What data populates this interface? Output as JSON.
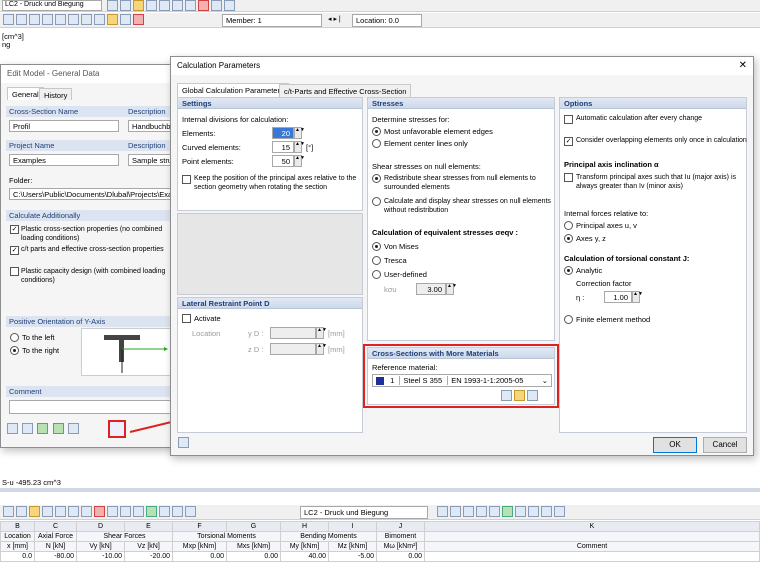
{
  "toolbar1": {
    "loadcase": "LC2 - Druck und Biegung"
  },
  "toolbar2": {
    "member": "Member: 1",
    "location": "Location: 0.0"
  },
  "bg_text": {
    "line1": "[cm^3]",
    "line2": "ng",
    "bottom": "S-u  -495.23 cm^3"
  },
  "edit_model": {
    "title": "Edit Model - General Data",
    "tabs": [
      "General",
      "History"
    ],
    "cross_section_name_label": "Cross-Section Name",
    "cross_section_name": "Profil",
    "description_label": "Description",
    "description_value": "Handbuchbe",
    "project_name_label": "Project Name",
    "project_name": "Examples",
    "project_desc_label": "Description",
    "project_desc": "Sample struc",
    "folder_label": "Folder:",
    "folder": "C:\\Users\\Public\\Documents\\Dlubal\\Projects\\Example",
    "calc_add_label": "Calculate Additionally",
    "opt1": "Plastic cross-section properties (no combined loading conditions)",
    "opt2": "c/t parts and effective cross-section properties",
    "opt3": "Plastic capacity design (with combined loading conditions)",
    "orientation_label": "Positive Orientation of Y-Axis",
    "to_left": "To the left",
    "to_right": "To the right",
    "comment_label": "Comment"
  },
  "calc": {
    "title": "Calculation Parameters",
    "tabs": [
      "Global Calculation Parameters",
      "c/t-Parts and Effective Cross-Section"
    ],
    "settings": {
      "head": "Settings",
      "internal_div": "Internal divisions for calculation:",
      "elements_label": "Elements:",
      "elements": "20",
      "curved_label": "Curved elements:",
      "curved": "15",
      "curved_unit": "[°]",
      "point_label": "Point elements:",
      "point": "50",
      "keep_pos": "Keep the position of the principal axes relative to the section geometry when rotating the section"
    },
    "lateral": {
      "head": "Lateral Restraint Point D",
      "activate": "Activate",
      "location": "Location",
      "y": "y D :",
      "z": "z D :",
      "unit": "[mm]"
    },
    "stresses": {
      "head": "Stresses",
      "determine": "Determine stresses for:",
      "most_unfav": "Most unfavorable element edges",
      "center": "Element center lines only",
      "shear_null": "Shear stresses on null elements:",
      "redistribute": "Redistribute shear stresses from null elements to surrounded elements",
      "calc_display": "Calculate and display shear stresses on null elements without redistribution",
      "equiv": "Calculation of equivalent stresses σeqv :",
      "von_mises": "Von Mises",
      "tresca": "Tresca",
      "user_def": "User-defined",
      "k_label": "kσu",
      "k_value": "3.00"
    },
    "materials": {
      "head": "Cross-Sections with More Materials",
      "ref_label": "Reference material:",
      "ref_num": "1",
      "ref_name": "Steel S 355",
      "ref_code": "EN 1993-1-1:2005-05"
    },
    "options": {
      "head": "Options",
      "auto_calc": "Automatic calculation after every change",
      "overlap": "Consider overlapping elements only once in calculation",
      "principal_head": "Principal axis inclination α",
      "transform": "Transform principal axes such that Iu (major axis) is always greater than Iv (minor axis)",
      "forces_head": "Internal forces relative to:",
      "axes_uv": "Principal axes u, v",
      "axes_yz": "Axes y, z",
      "torsion_head": "Calculation of torsional constant J:",
      "analytic": "Analytic",
      "corr_factor": "Correction factor",
      "eta": "η :",
      "eta_value": "1.00",
      "fem": "Finite element method"
    },
    "ok": "OK",
    "cancel": "Cancel"
  },
  "table": {
    "loadcase": "LC2 - Druck und Biegung",
    "cols": [
      "B",
      "C",
      "D",
      "E",
      "F",
      "G",
      "H",
      "I",
      "J",
      "K"
    ],
    "group1": [
      "Location",
      "Axial Force",
      "Shear Forces",
      "",
      "Torsional Moments",
      "",
      "Bending Moments",
      "",
      "Bimoment",
      ""
    ],
    "group2": [
      "x [mm]",
      "N [kN]",
      "Vy [kN]",
      "Vz [kN]",
      "Mxp [kNm]",
      "Mxs [kNm]",
      "My [kNm]",
      "Mz [kNm]",
      "Mω [kNm²]",
      "Comment"
    ],
    "row": [
      "0.0",
      "-80.00",
      "-10.00",
      "-20.00",
      "0.00",
      "0.00",
      "40.00",
      "-5.00",
      "0.00",
      ""
    ]
  }
}
